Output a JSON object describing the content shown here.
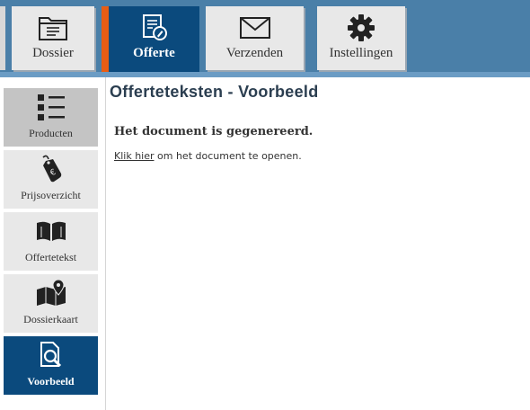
{
  "top_nav": {
    "tabs": [
      {
        "label": "Dossier",
        "icon": "folder-icon"
      },
      {
        "label": "Offerte",
        "icon": "quote-document-icon",
        "active": true
      },
      {
        "label": "Verzenden",
        "icon": "envelope-icon"
      },
      {
        "label": "Instellingen",
        "icon": "gear-icon"
      }
    ]
  },
  "sidebar": {
    "items": [
      {
        "label": "Producten",
        "icon": "list-icon",
        "state": "selected"
      },
      {
        "label": "Prijsoverzicht",
        "icon": "price-tag-icon"
      },
      {
        "label": "Offertetekst",
        "icon": "open-book-icon"
      },
      {
        "label": "Dossierkaart",
        "icon": "map-pin-icon"
      },
      {
        "label": "Voorbeeld",
        "icon": "document-search-icon",
        "state": "active"
      }
    ]
  },
  "main": {
    "title": "Offerteteksten - Voorbeeld",
    "status_message": "Het document is gegenereerd.",
    "open_link_text": "Klik hier",
    "open_suffix": " om het document te openen."
  },
  "colors": {
    "topbar_bg": "#4a7fa8",
    "active_bg": "#0b4a7d",
    "accent": "#e85d14",
    "tile_bg": "#e8e8e8"
  }
}
